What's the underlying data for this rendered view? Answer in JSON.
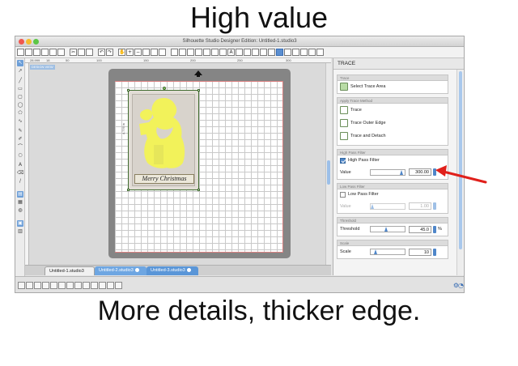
{
  "captions": {
    "top": "High value",
    "bottom": "More details, thicker edge."
  },
  "window": {
    "title": "Silhouette Studio Designer Edition: Untitled-1.studio3"
  },
  "ruler": {
    "marks": [
      "28.999",
      "18",
      "50",
      "100",
      "150",
      "200",
      "250",
      "300"
    ]
  },
  "workspace": {
    "design_view_label": "DESIGN VIEW"
  },
  "canvas": {
    "image_caption": "Merry Christmas",
    "dimension": "4.776 in"
  },
  "doc_tabs": [
    {
      "label": "Untitled-1.studio3"
    },
    {
      "label": "Untitled-2.studio3"
    },
    {
      "label": "Untitled-3.studio3"
    }
  ],
  "panel": {
    "title": "TRACE",
    "trace_section": {
      "title": "Trace",
      "select_area_label": "Select Trace Area"
    },
    "method_section": {
      "title": "Apply Trace Method",
      "items": [
        {
          "label": "Trace"
        },
        {
          "label": "Trace Outer Edge"
        },
        {
          "label": "Trace and Detach"
        }
      ]
    },
    "high_pass": {
      "title": "High Pass Filter",
      "checkbox_label": "High Pass Filter",
      "checked": true,
      "value_label": "Value",
      "value": "300.00",
      "level": 0.95
    },
    "low_pass": {
      "title": "Low Pass Filter",
      "checkbox_label": "Low Pass Filter",
      "checked": false,
      "value_label": "Value",
      "value": "1.00",
      "level": 0.0
    },
    "threshold": {
      "title": "Threshold",
      "label": "Threshold",
      "value": "45.0",
      "unit": "%",
      "level": 0.45
    },
    "scale": {
      "title": "Scale",
      "label": "Scale",
      "value": "10",
      "level": 0.1
    }
  },
  "colors": {
    "accent": "#4f86c9",
    "annotation_arrow": "#e0201b",
    "santa_fill": "#f2f25a"
  },
  "icons": [
    "select-tool-icon",
    "pan-tool-icon",
    "zoom-in-icon",
    "zoom-out-icon",
    "settings-gear-icon",
    "help-icon"
  ]
}
